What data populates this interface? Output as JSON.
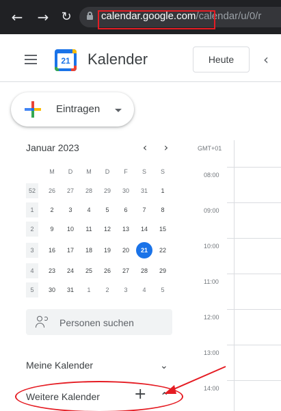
{
  "browser": {
    "back_icon": "arrow-left-icon",
    "forward_icon": "arrow-right-icon",
    "reload_icon": "reload-icon",
    "url_domain": "calendar.google.com",
    "url_path": "/calendar/u/0/r"
  },
  "header": {
    "logo_day": "21",
    "app_title": "Kalender",
    "today_label": "Heute"
  },
  "create": {
    "label": "Eintragen"
  },
  "mini_calendar": {
    "month": "Januar 2023",
    "weekdays": [
      "M",
      "D",
      "M",
      "D",
      "F",
      "S",
      "S"
    ],
    "weeks": [
      {
        "num": "52",
        "days": [
          "26",
          "27",
          "28",
          "29",
          "30",
          "31",
          "1"
        ]
      },
      {
        "num": "1",
        "days": [
          "2",
          "3",
          "4",
          "5",
          "6",
          "7",
          "8"
        ]
      },
      {
        "num": "2",
        "days": [
          "9",
          "10",
          "11",
          "12",
          "13",
          "14",
          "15"
        ]
      },
      {
        "num": "3",
        "days": [
          "16",
          "17",
          "18",
          "19",
          "20",
          "21",
          "22"
        ]
      },
      {
        "num": "4",
        "days": [
          "23",
          "24",
          "25",
          "26",
          "27",
          "28",
          "29"
        ]
      },
      {
        "num": "5",
        "days": [
          "30",
          "31",
          "1",
          "2",
          "3",
          "4",
          "5"
        ]
      }
    ],
    "today": "21"
  },
  "search_people": {
    "placeholder": "Personen suchen"
  },
  "my_calendars": {
    "title": "Meine Kalender"
  },
  "other_calendars": {
    "title": "Weitere Kalender"
  },
  "time_grid": {
    "timezone": "GMT+01",
    "hours": [
      "08:00",
      "09:00",
      "10:00",
      "11:00",
      "12:00",
      "13:00",
      "14:00"
    ]
  },
  "colors": {
    "accent": "#1a73e8",
    "annotation": "#e51c23"
  }
}
